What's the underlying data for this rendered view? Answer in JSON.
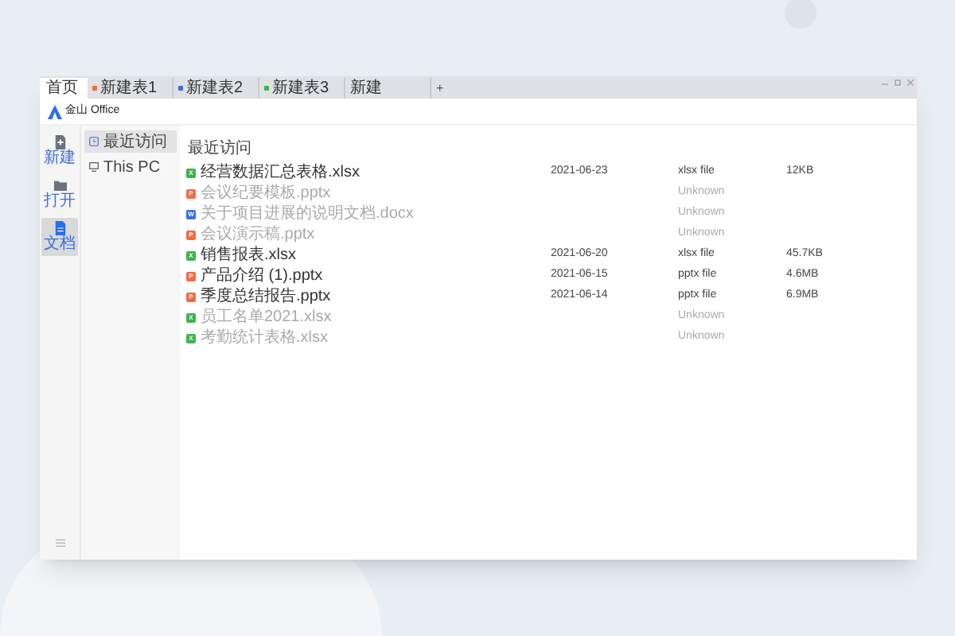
{
  "tabs": [
    {
      "label": "首页",
      "selected": true,
      "kind": "home"
    },
    {
      "label": "新建表1",
      "selected": false,
      "kind": "pptx"
    },
    {
      "label": "新建表2",
      "selected": false,
      "kind": "docx"
    },
    {
      "label": "新建表3",
      "selected": false,
      "kind": "xlsx"
    },
    {
      "label": "新建",
      "selected": false,
      "kind": "plain"
    }
  ],
  "new_tab_button": "+",
  "app_title": "金山 Office",
  "rail": [
    {
      "label": "新建",
      "kind": "new",
      "selected": false
    },
    {
      "label": "打开",
      "kind": "open",
      "selected": false
    },
    {
      "label": "文档",
      "kind": "docs",
      "selected": true
    }
  ],
  "nav": [
    {
      "label": "最近访问",
      "kind": "recent",
      "selected": true
    },
    {
      "label": "This PC",
      "kind": "pc",
      "selected": false
    }
  ],
  "section_title": "最近访问",
  "files": [
    {
      "name": "经营数据汇总表格.xlsx",
      "kind": "xlsx",
      "icon_text": "X",
      "available": true,
      "date": "2021-06-23",
      "type": "xlsx file",
      "size": "12KB"
    },
    {
      "name": "会议纪要模板.pptx",
      "kind": "pptx",
      "icon_text": "P",
      "available": false,
      "type": "Unknown"
    },
    {
      "name": "关于项目进展的说明文档.docx",
      "kind": "docx",
      "icon_text": "W",
      "available": false,
      "type": "Unknown"
    },
    {
      "name": "会议演示稿.pptx",
      "kind": "pptx",
      "icon_text": "P",
      "available": false,
      "type": "Unknown"
    },
    {
      "name": "销售报表.xlsx",
      "kind": "xlsx",
      "icon_text": "X",
      "available": true,
      "date": "2021-06-20",
      "type": "xlsx file",
      "size": "45.7KB"
    },
    {
      "name": "产品介绍 (1).pptx",
      "kind": "pptx",
      "icon_text": "P",
      "available": true,
      "date": "2021-06-15",
      "type": "pptx file",
      "size": "4.6MB"
    },
    {
      "name": "季度总结报告.pptx",
      "kind": "pptx",
      "icon_text": "P",
      "available": true,
      "date": "2021-06-14",
      "type": "pptx file",
      "size": "6.9MB"
    },
    {
      "name": "员工名单2021.xlsx",
      "kind": "xlsx",
      "icon_text": "X",
      "available": false,
      "type": "Unknown"
    },
    {
      "name": "考勤统计表格.xlsx",
      "kind": "xlsx",
      "icon_text": "X",
      "available": false,
      "type": "Unknown"
    }
  ]
}
